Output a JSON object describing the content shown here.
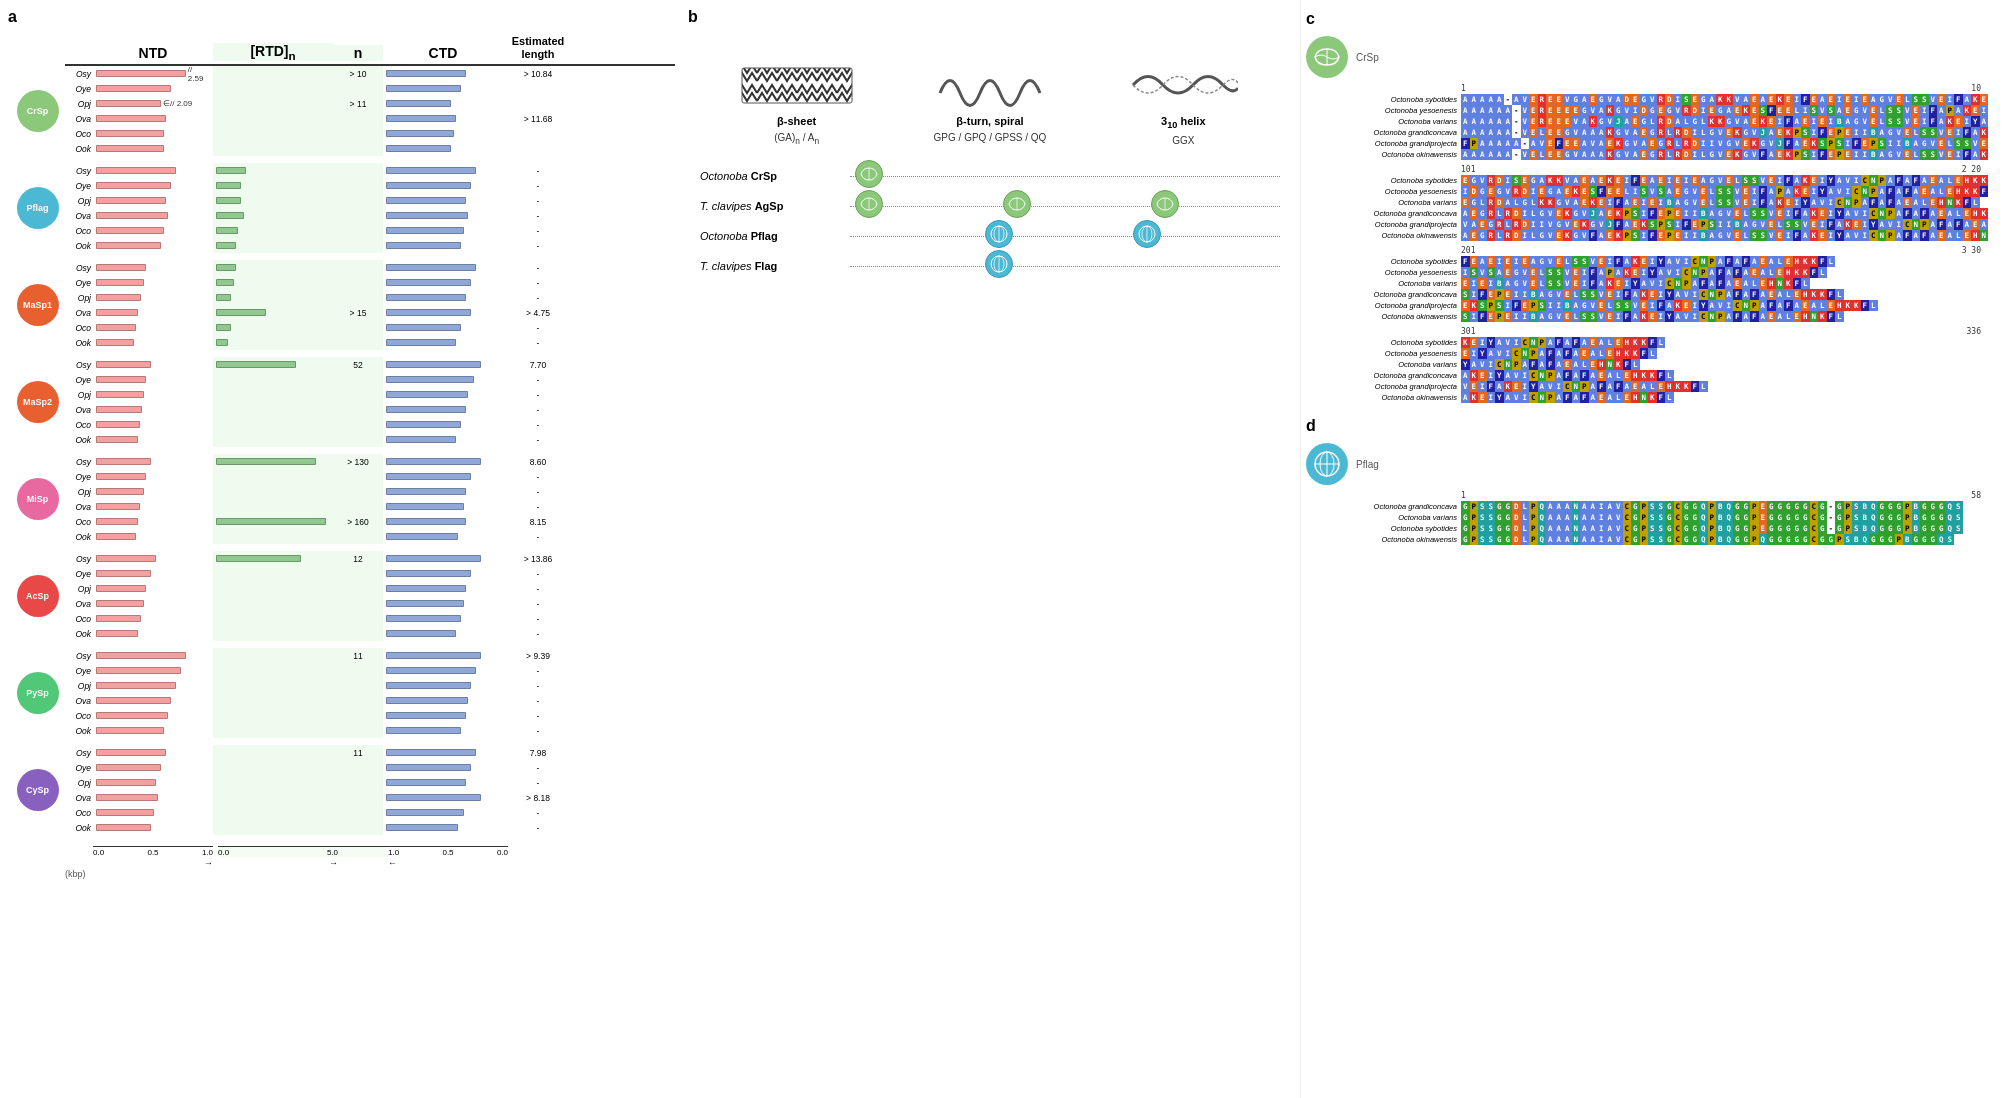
{
  "panel_a": {
    "label": "a",
    "columns": {
      "ntd": "NTD",
      "rtd": "[RTD]n",
      "n": "n",
      "ctd": "CTD",
      "est": "Estimated length"
    },
    "kbp_label": "(kbp)",
    "groups": [
      {
        "name": "CrSp",
        "icon_color": "#8bc87a",
        "rows": [
          {
            "sp": "Osy",
            "ntd_w": 90,
            "ntd_note": "// 2.59",
            "rtd_w": 0,
            "n_val": "> 10",
            "ctd_w": 80,
            "est": "> 10.84"
          },
          {
            "sp": "Oye",
            "ntd_w": 75,
            "rtd_w": 0,
            "n_val": "",
            "ctd_w": 75,
            "est": ""
          },
          {
            "sp": "Opj",
            "ntd_w": 65,
            "ntd_note": "∈// 2.09",
            "rtd_w": 0,
            "n_val": "> 11",
            "ctd_w": 65,
            "est": ""
          },
          {
            "sp": "Ova",
            "ntd_w": 70,
            "rtd_w": 0,
            "n_val": "",
            "ctd_w": 70,
            "est": "> 11.68"
          },
          {
            "sp": "Oco",
            "ntd_w": 68,
            "rtd_w": 0,
            "n_val": "",
            "ctd_w": 68,
            "est": ""
          },
          {
            "sp": "Ook",
            "ntd_w": 68,
            "rtd_w": 0,
            "n_val": "",
            "ctd_w": 65,
            "est": ""
          }
        ]
      },
      {
        "name": "Pflag",
        "icon_color": "#4bb8d4",
        "rows": [
          {
            "sp": "Osy",
            "ntd_w": 80,
            "rtd_w": 30,
            "n_val": "",
            "ctd_w": 90,
            "est": "-"
          },
          {
            "sp": "Oye",
            "ntd_w": 75,
            "rtd_w": 25,
            "n_val": "",
            "ctd_w": 85,
            "est": "-"
          },
          {
            "sp": "Opj",
            "ntd_w": 70,
            "rtd_w": 25,
            "n_val": "",
            "ctd_w": 80,
            "est": "-"
          },
          {
            "sp": "Ova",
            "ntd_w": 72,
            "rtd_w": 28,
            "n_val": "",
            "ctd_w": 82,
            "est": "-"
          },
          {
            "sp": "Oco",
            "ntd_w": 68,
            "rtd_w": 22,
            "n_val": "",
            "ctd_w": 78,
            "est": "-"
          },
          {
            "sp": "Ook",
            "ntd_w": 65,
            "rtd_w": 20,
            "n_val": "",
            "ctd_w": 75,
            "est": "-"
          }
        ]
      },
      {
        "name": "MaSp1",
        "icon_color": "#e86030",
        "rows": [
          {
            "sp": "Osy",
            "ntd_w": 50,
            "rtd_w": 20,
            "n_val": "",
            "ctd_w": 90,
            "est": "-"
          },
          {
            "sp": "Oye",
            "ntd_w": 48,
            "rtd_w": 18,
            "n_val": "",
            "ctd_w": 85,
            "est": "-"
          },
          {
            "sp": "Opj",
            "ntd_w": 45,
            "rtd_w": 15,
            "n_val": "",
            "ctd_w": 80,
            "est": "-"
          },
          {
            "sp": "Ova",
            "ntd_w": 42,
            "rtd_w": 50,
            "n_val": "> 15",
            "ctd_w": 85,
            "est": "> 4.75"
          },
          {
            "sp": "Oco",
            "ntd_w": 40,
            "rtd_w": 15,
            "n_val": "",
            "ctd_w": 75,
            "est": "-"
          },
          {
            "sp": "Ook",
            "ntd_w": 38,
            "rtd_w": 12,
            "n_val": "",
            "ctd_w": 70,
            "est": "-"
          }
        ]
      },
      {
        "name": "MaSp2",
        "icon_color": "#e86030",
        "rows": [
          {
            "sp": "Osy",
            "ntd_w": 55,
            "rtd_w": 80,
            "n_val": "52",
            "ctd_w": 95,
            "est": "7.70"
          },
          {
            "sp": "Oye",
            "ntd_w": 50,
            "rtd_w": 0,
            "n_val": "",
            "ctd_w": 88,
            "est": "-"
          },
          {
            "sp": "Opj",
            "ntd_w": 48,
            "rtd_w": 0,
            "n_val": "",
            "ctd_w": 82,
            "est": "-"
          },
          {
            "sp": "Ova",
            "ntd_w": 46,
            "rtd_w": 0,
            "n_val": "",
            "ctd_w": 80,
            "est": "-"
          },
          {
            "sp": "Oco",
            "ntd_w": 44,
            "rtd_w": 0,
            "n_val": "",
            "ctd_w": 75,
            "est": "-"
          },
          {
            "sp": "Ook",
            "ntd_w": 42,
            "rtd_w": 0,
            "n_val": "",
            "ctd_w": 70,
            "est": "-"
          }
        ]
      },
      {
        "name": "MiSp",
        "icon_color": "#e868a0",
        "rows": [
          {
            "sp": "Osy",
            "ntd_w": 55,
            "rtd_w": 100,
            "n_val": "> 130",
            "ctd_w": 95,
            "est": "8.60"
          },
          {
            "sp": "Oye",
            "ntd_w": 50,
            "rtd_w": 0,
            "n_val": "",
            "ctd_w": 85,
            "est": "-"
          },
          {
            "sp": "Opj",
            "ntd_w": 48,
            "rtd_w": 0,
            "n_val": "",
            "ctd_w": 80,
            "est": "-"
          },
          {
            "sp": "Ova",
            "ntd_w": 44,
            "rtd_w": 0,
            "n_val": "",
            "ctd_w": 78,
            "est": "-"
          },
          {
            "sp": "Oco",
            "ntd_w": 42,
            "rtd_w": 110,
            "n_val": "> 160",
            "ctd_w": 80,
            "est": "8.15"
          },
          {
            "sp": "Ook",
            "ntd_w": 40,
            "rtd_w": 0,
            "n_val": "",
            "ctd_w": 72,
            "est": "-"
          }
        ]
      },
      {
        "name": "AcSp",
        "icon_color": "#e84848",
        "rows": [
          {
            "sp": "Osy",
            "ntd_w": 60,
            "rtd_w": 85,
            "n_val": "12",
            "ctd_w": 95,
            "est": "> 13.86"
          },
          {
            "sp": "Oye",
            "ntd_w": 55,
            "rtd_w": 0,
            "n_val": "",
            "ctd_w": 85,
            "est": "-"
          },
          {
            "sp": "Opj",
            "ntd_w": 50,
            "rtd_w": 0,
            "n_val": "",
            "ctd_w": 80,
            "est": "-"
          },
          {
            "sp": "Ova",
            "ntd_w": 48,
            "rtd_w": 0,
            "n_val": "",
            "ctd_w": 78,
            "est": "-"
          },
          {
            "sp": "Oco",
            "ntd_w": 45,
            "rtd_w": 0,
            "n_val": "",
            "ctd_w": 75,
            "est": "-"
          },
          {
            "sp": "Ook",
            "ntd_w": 42,
            "rtd_w": 0,
            "n_val": "",
            "ctd_w": 70,
            "est": "-"
          }
        ]
      },
      {
        "name": "PySp",
        "icon_color": "#50c878",
        "rows": [
          {
            "sp": "Osy",
            "ntd_w": 90,
            "rtd_w": 0,
            "n_val": "11",
            "ctd_w": 95,
            "est": "> 9.39"
          },
          {
            "sp": "Oye",
            "ntd_w": 85,
            "rtd_w": 0,
            "n_val": "",
            "ctd_w": 90,
            "est": "-"
          },
          {
            "sp": "Opj",
            "ntd_w": 80,
            "rtd_w": 0,
            "n_val": "",
            "ctd_w": 85,
            "est": "-"
          },
          {
            "sp": "Ova",
            "ntd_w": 75,
            "rtd_w": 0,
            "n_val": "",
            "ctd_w": 82,
            "est": "-"
          },
          {
            "sp": "Oco",
            "ntd_w": 72,
            "rtd_w": 0,
            "n_val": "",
            "ctd_w": 80,
            "est": "-"
          },
          {
            "sp": "Ook",
            "ntd_w": 68,
            "rtd_w": 0,
            "n_val": "",
            "ctd_w": 75,
            "est": "-"
          }
        ]
      },
      {
        "name": "CySp",
        "icon_color": "#8860c0",
        "rows": [
          {
            "sp": "Osy",
            "ntd_w": 70,
            "rtd_w": 0,
            "n_val": "11",
            "ctd_w": 90,
            "est": "7.98"
          },
          {
            "sp": "Oye",
            "ntd_w": 65,
            "rtd_w": 0,
            "n_val": "",
            "ctd_w": 85,
            "est": "-"
          },
          {
            "sp": "Opj",
            "ntd_w": 60,
            "rtd_w": 0,
            "n_val": "",
            "ctd_w": 80,
            "est": "-"
          },
          {
            "sp": "Ova",
            "ntd_w": 62,
            "rtd_w": 0,
            "n_val": "",
            "ctd_w": 95,
            "est": "> 8.18"
          },
          {
            "sp": "Oco",
            "ntd_w": 58,
            "rtd_w": 0,
            "n_val": "",
            "ctd_w": 78,
            "est": "-"
          },
          {
            "sp": "Ook",
            "ntd_w": 55,
            "rtd_w": 0,
            "n_val": "",
            "ctd_w": 72,
            "est": "-"
          }
        ]
      }
    ]
  },
  "panel_b": {
    "label": "b",
    "structures": [
      {
        "name": "β-sheet",
        "seq": "(GA)n / An",
        "type": "zigzag"
      },
      {
        "name": "β-turn, spiral",
        "seq": "GPG / GPQ / GPSS / QQ",
        "type": "coil"
      },
      {
        "name": "310 helix",
        "seq": "GGX",
        "type": "helix"
      }
    ],
    "proteins": [
      {
        "name_italic": "Octonoba",
        "name_bold": "CrSp",
        "icon_color": "#8bc87a",
        "icon_type": "green",
        "positions": [
          0
        ]
      },
      {
        "name_italic": "T. clavipes",
        "name_bold": "AgSp",
        "icon_color": "#8bc87a",
        "icon_type": "green",
        "positions": [
          0,
          1,
          2
        ]
      },
      {
        "name_italic": "Octonoba",
        "name_bold": "Pflag",
        "icon_color": "#4bb8d4",
        "icon_type": "blue",
        "positions": [
          1,
          2
        ]
      },
      {
        "name_italic": "T. clavipes",
        "name_bold": "Flag",
        "icon_color": "#4bb8d4",
        "icon_type": "blue",
        "positions": [
          1
        ]
      }
    ]
  },
  "panel_c": {
    "label": "c",
    "icon_color": "#8bc87a",
    "num_markers": [
      "1",
      "10",
      "101",
      "20",
      "201",
      "3 30",
      "301",
      "336"
    ],
    "sequences": [
      {
        "species": "Octonoba sybotides",
        "seq": "AAAAA-AVEREEVG-AEGV-ADEGVRDISEGAKKVAE-AEK-EIFEAEI-EI-EAGVELSSVEIFAKEIY-AVICHPAFAFAEA-LEHKKFL"
      },
      {
        "species": "Octonoba yesoenesis",
        "seq": "AAAAA-AVEREEEEGV-AKGVIDGEGVRDIE-GAEKESFEELI-SVS-EAGVELSSVEIFAPAKEIY-AVICHPAFAFAEA-LEHKKFL"
      },
      {
        "species": "Octonoba varians",
        "seq": "AAAAAA-VEREEEVA-KGVJAEGLRDA-LGVKKGV-AEK-EIFAEI-EI-BAGVELSSVEIFAKEIY-AVICNPAFAFAEA-LEHNKFL"
      },
      {
        "species": "Octonoba grandiconcava",
        "seq": "AAAAA-AVELEEGVAAAKGV-AEGLRDI-LGVEKGV-JAEK-PSIFEP-EI-BAGVELSSVEIFAKEIY-AVICHPAFAFAEA-LEHKKFL"
      },
      {
        "species": "Octonoba grandiprojecta",
        "seq": "FPAAAAA-AVEFEEAVAEKGV-AEGLRDIIVGVEKGVJ-FAEKS-PSIFEP-SI-BAGVELSSVEIFAKEIY-AVICHPAFAFAEA-LEHKKFL"
      },
      {
        "species": "Octonoba okinawensis",
        "seq": "AAAAA-AVELEEGVAAAKGV-AEGLRDI-LGVEKGV-FAEK-PSIFEP-EI-BAGVELSSVEIFAKEIY-AVICNPAFAFAEA-LEHKKFL"
      }
    ]
  },
  "panel_d": {
    "label": "d",
    "icon_color": "#4bb8d4",
    "sequences": [
      {
        "species": "Octonoba grandiconcava",
        "num": "1",
        "end_num": "58"
      },
      {
        "species": "Octonoba varians"
      },
      {
        "species": "Octonoba sybotides"
      },
      {
        "species": "Octonoba okinawensis"
      }
    ]
  }
}
